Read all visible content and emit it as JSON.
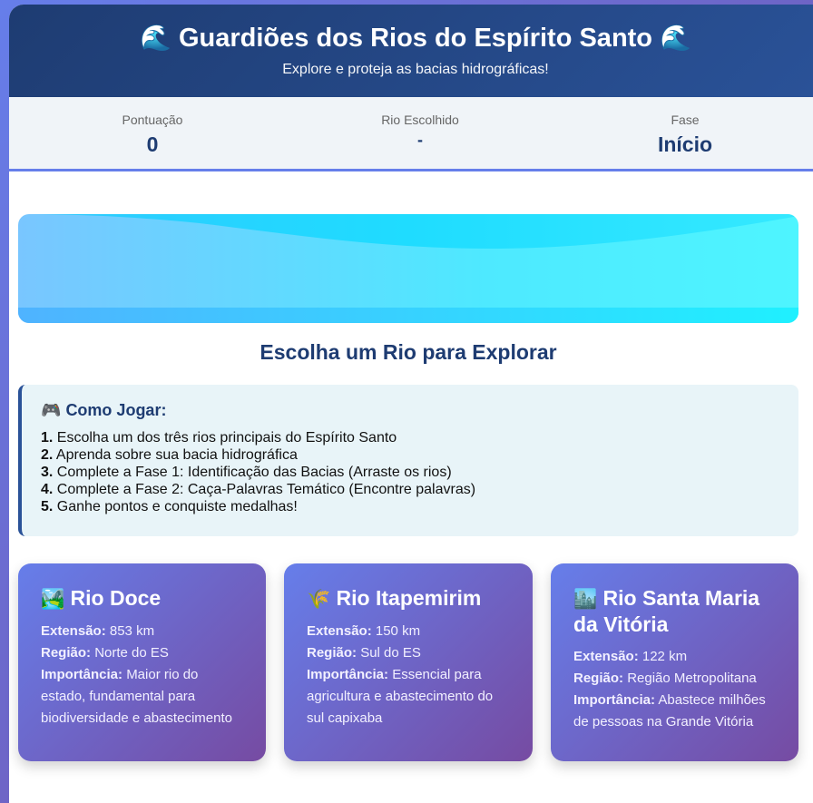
{
  "header": {
    "wave_icon": "🌊",
    "title": "Guardiões dos Rios do Espírito Santo",
    "subtitle": "Explore e proteja as bacias hidrográficas!"
  },
  "stats": [
    {
      "label": "Pontuação",
      "value": "0"
    },
    {
      "label": "Rio Escolhido",
      "value": "-"
    },
    {
      "label": "Fase",
      "value": "Início"
    }
  ],
  "section_title": "Escolha um Rio para Explorar",
  "howto": {
    "icon": "🎮",
    "title": "Como Jogar:",
    "steps": [
      {
        "num": "1.",
        "text": "Escolha um dos três rios principais do Espírito Santo"
      },
      {
        "num": "2.",
        "text": "Aprenda sobre sua bacia hidrográfica"
      },
      {
        "num": "3.",
        "text": "Complete a Fase 1: Identificação das Bacias (Arraste os rios)"
      },
      {
        "num": "4.",
        "text": "Complete a Fase 2: Caça-Palavras Temático (Encontre palavras)"
      },
      {
        "num": "5.",
        "text": "Ganhe pontos e conquiste medalhas!"
      }
    ]
  },
  "labels": {
    "extensao": "Extensão:",
    "regiao": "Região:",
    "importancia": "Importância:"
  },
  "rivers": [
    {
      "icon": "🏞️",
      "name": "Rio Doce",
      "extensao": "853 km",
      "regiao": "Norte do ES",
      "importancia": "Maior rio do estado, fundamental para biodiversidade e abastecimento"
    },
    {
      "icon": "🌾",
      "name": "Rio Itapemirim",
      "extensao": "150 km",
      "regiao": "Sul do ES",
      "importancia": "Essencial para agricultura e abastecimento do sul capixaba"
    },
    {
      "icon": "🏙️",
      "name": "Rio Santa Maria da Vitória",
      "extensao": "122 km",
      "regiao": "Região Metropolitana",
      "importancia": "Abastece milhões de pessoas na Grande Vitória"
    }
  ]
}
